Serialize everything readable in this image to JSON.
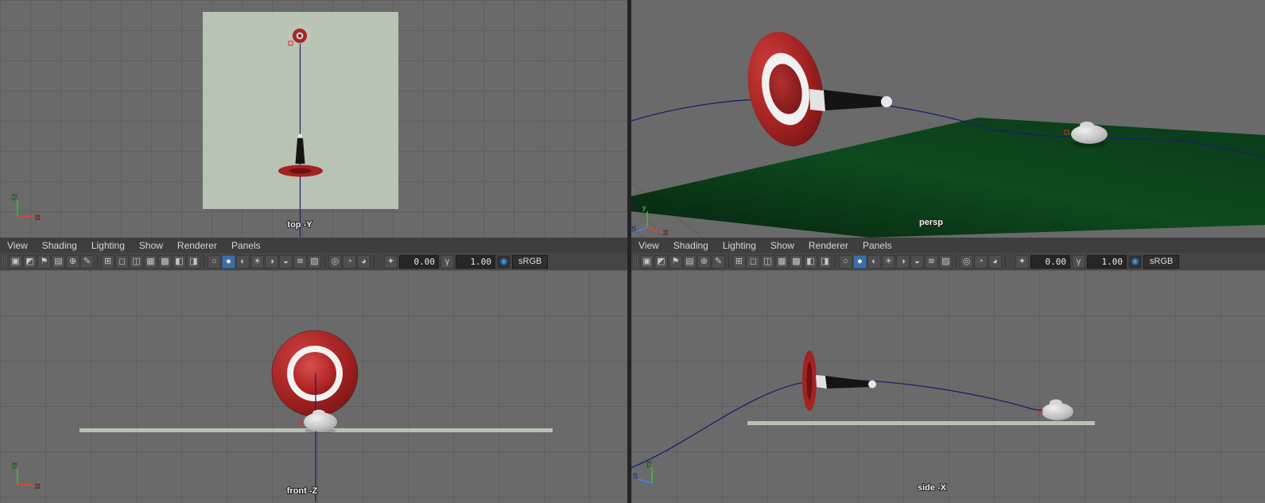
{
  "panel_menus": [
    "View",
    "Shading",
    "Lighting",
    "Show",
    "Renderer",
    "Panels"
  ],
  "toolbar": {
    "camera_group": [
      {
        "name": "select-camera-icon",
        "glyph": "▣"
      },
      {
        "name": "lock-camera-icon",
        "glyph": "◩"
      },
      {
        "name": "bookmark-icon",
        "glyph": "⚑"
      },
      {
        "name": "image-plane-icon",
        "glyph": "▤"
      },
      {
        "name": "pan-zoom-icon",
        "glyph": "⊕"
      },
      {
        "name": "grease-pencil-icon",
        "glyph": "✎"
      }
    ],
    "gates_group": [
      {
        "name": "grid-icon",
        "glyph": "⊞"
      },
      {
        "name": "film-gate-icon",
        "glyph": "◻"
      },
      {
        "name": "resolution-gate-icon",
        "glyph": "◫"
      },
      {
        "name": "gate-mask-icon",
        "glyph": "▦"
      },
      {
        "name": "field-chart-icon",
        "glyph": "▩"
      },
      {
        "name": "safe-action-icon",
        "glyph": "◧"
      },
      {
        "name": "safe-title-icon",
        "glyph": "◨"
      }
    ],
    "shading_group": [
      {
        "name": "wireframe-icon",
        "glyph": "○"
      },
      {
        "name": "smooth-shade-icon",
        "glyph": "●",
        "variant": "active"
      },
      {
        "name": "textured-icon",
        "glyph": "◐"
      },
      {
        "name": "use-all-lights-icon",
        "glyph": "☀"
      },
      {
        "name": "shadows-icon",
        "glyph": "◑"
      },
      {
        "name": "ssao-icon",
        "glyph": "◒"
      },
      {
        "name": "motion-blur-icon",
        "glyph": "≋"
      },
      {
        "name": "anti-aliasing-icon",
        "glyph": "▨"
      }
    ],
    "isolate_group": [
      {
        "name": "isolate-select-icon",
        "glyph": "◎"
      },
      {
        "name": "x-ray-icon",
        "glyph": "◔"
      },
      {
        "name": "x-ray-joints-icon",
        "glyph": "◕"
      }
    ],
    "exposure": {
      "icon": "✦",
      "value": "0.00"
    },
    "gamma": {
      "icon": "γ",
      "value": "1.00"
    },
    "color_management": {
      "icon": "◉",
      "label": "sRGB"
    }
  },
  "viewports": {
    "top": {
      "label": "top -Y",
      "axes": [
        {
          "label": "y",
          "color": "#35c435"
        },
        {
          "label": "x",
          "color": "#e8412e"
        }
      ]
    },
    "persp": {
      "label": "persp",
      "axes": [
        {
          "label": "y",
          "color": "#35c435"
        },
        {
          "label": "x",
          "color": "#e8412e"
        },
        {
          "label": "z",
          "color": "#4d7dff"
        }
      ]
    },
    "front": {
      "label": "front -Z",
      "axes": [
        {
          "label": "y",
          "color": "#35c435"
        },
        {
          "label": "x",
          "color": "#e8412e"
        }
      ]
    },
    "side": {
      "label": "side -X",
      "axes": [
        {
          "label": "y",
          "color": "#35c435"
        },
        {
          "label": "z",
          "color": "#4d7dff"
        }
      ]
    }
  },
  "scene": {
    "colors": {
      "plane": "#b9c3b4",
      "ground": "#0d4a1e",
      "curve": "#1c1c6e",
      "torus_red": "#a32222",
      "torus_dark": "#6e1111",
      "ring_white": "#f1f1f1",
      "stone": "#cccccc",
      "cone": "#141414",
      "selection": "#cc3333"
    }
  }
}
